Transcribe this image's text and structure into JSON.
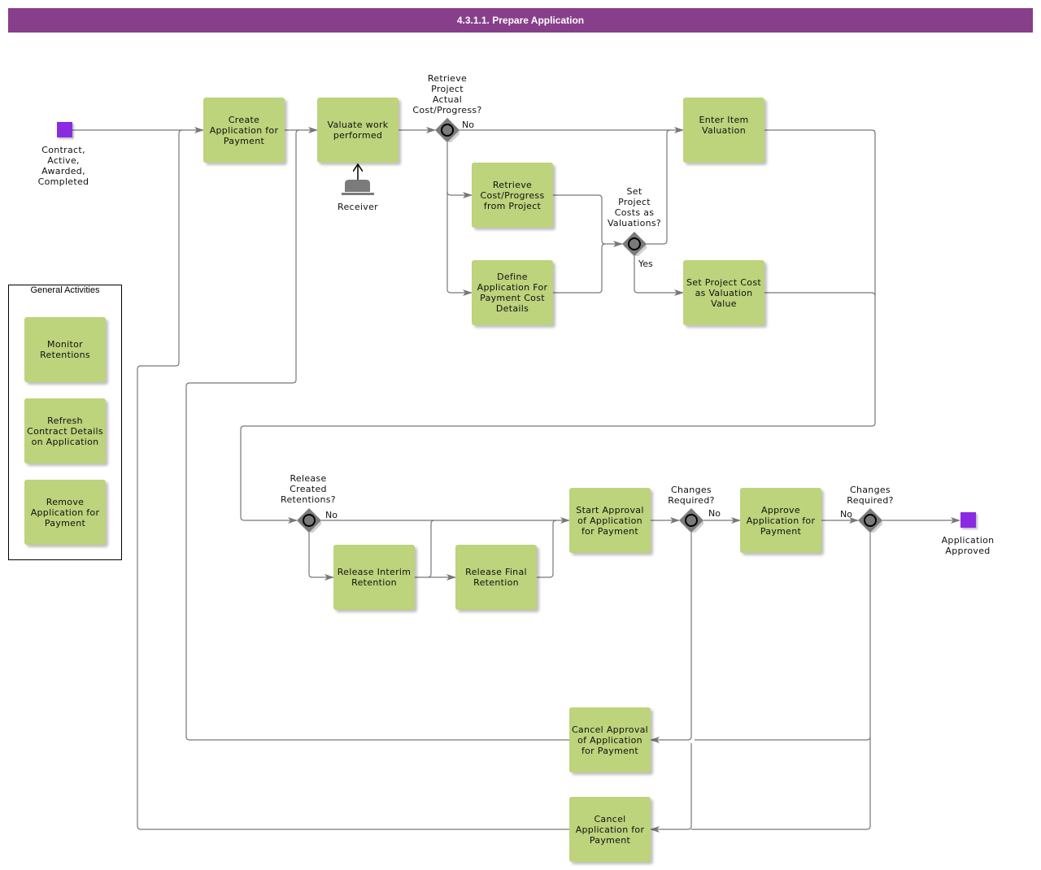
{
  "header": {
    "title": "4.3.1.1. Prepare Application"
  },
  "colors": {
    "header": "#873f8b",
    "task": "#bdd37c",
    "event": "#8a2be2",
    "gateway": "#7a7a7a",
    "connector": "#777777"
  },
  "events": {
    "start": {
      "label": "Contract,\nActive,\nAwarded,\nCompleted"
    },
    "end": {
      "label": "Application\nApproved"
    }
  },
  "receiver": {
    "label": "Receiver",
    "icon": "receiver-icon"
  },
  "tasks": {
    "create_application": "Create Application for Payment",
    "valuate_work": "Valuate work performed",
    "retrieve_cost": "Retrieve Cost/Progress from Project",
    "define_application": "Define Application For Payment Cost Details",
    "enter_item_valuation": "Enter Item Valuation",
    "set_project_cost": "Set Project Cost as Valuation Value",
    "release_interim": "Release Interim Retention",
    "release_final": "Release Final Retention",
    "start_approval": "Start Approval of Application for Payment",
    "approve_application": "Approve Application for Payment",
    "cancel_approval": "Cancel Approval of Application for Payment",
    "cancel_application": "Cancel Application for Payment"
  },
  "gateways": {
    "retrieve_project": {
      "label": "Retrieve\nProject\nActual\nCost/Progress?",
      "no": "No"
    },
    "set_project_costs": {
      "label": "Set\nProject\nCosts as\nValuations?",
      "yes": "Yes"
    },
    "release_retentions": {
      "label": "Release\nCreated\nRetentions?",
      "no": "No"
    },
    "changes_required_1": {
      "label": "Changes\nRequired?",
      "no": "No"
    },
    "changes_required_2": {
      "label": "Changes\nRequired?",
      "no": "No"
    }
  },
  "general_activities": {
    "title": "General Activities",
    "items": [
      "Monitor Retentions",
      "Refresh Contract Details on Application",
      "Remove Application for Payment"
    ]
  }
}
